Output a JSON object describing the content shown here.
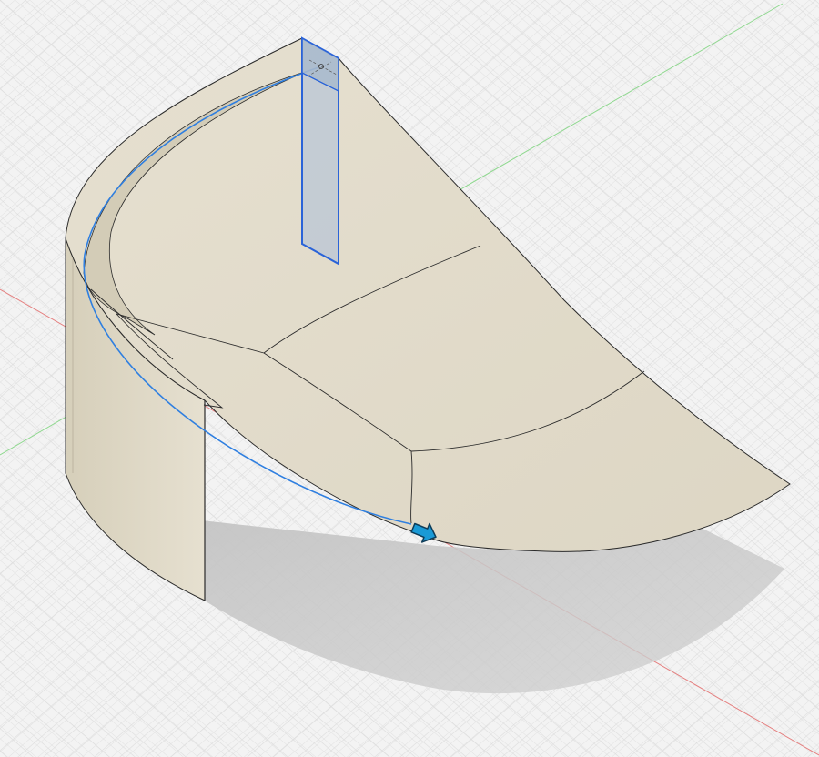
{
  "viewport": {
    "background": "#f3f3f3",
    "grid": {
      "visible": true,
      "minor_color": "#d9d9d9",
      "major_color": "#c4c4c4"
    },
    "axes": {
      "x_axis_color": "#e06a6a",
      "y_axis_color": "#7fd27f"
    }
  },
  "model": {
    "body_color": "#e2dccb",
    "body_side_color": "#d8d1bd",
    "edge_color": "#2b2b2b",
    "shadow_color": "#c9c9c9",
    "profile_color": "#b8c4d2",
    "profile_edge_color": "#2a63d8",
    "path_color": "#2f7fe0"
  },
  "manipulator": {
    "icon": "arrow-right-icon",
    "color": "#1a9ad6"
  }
}
